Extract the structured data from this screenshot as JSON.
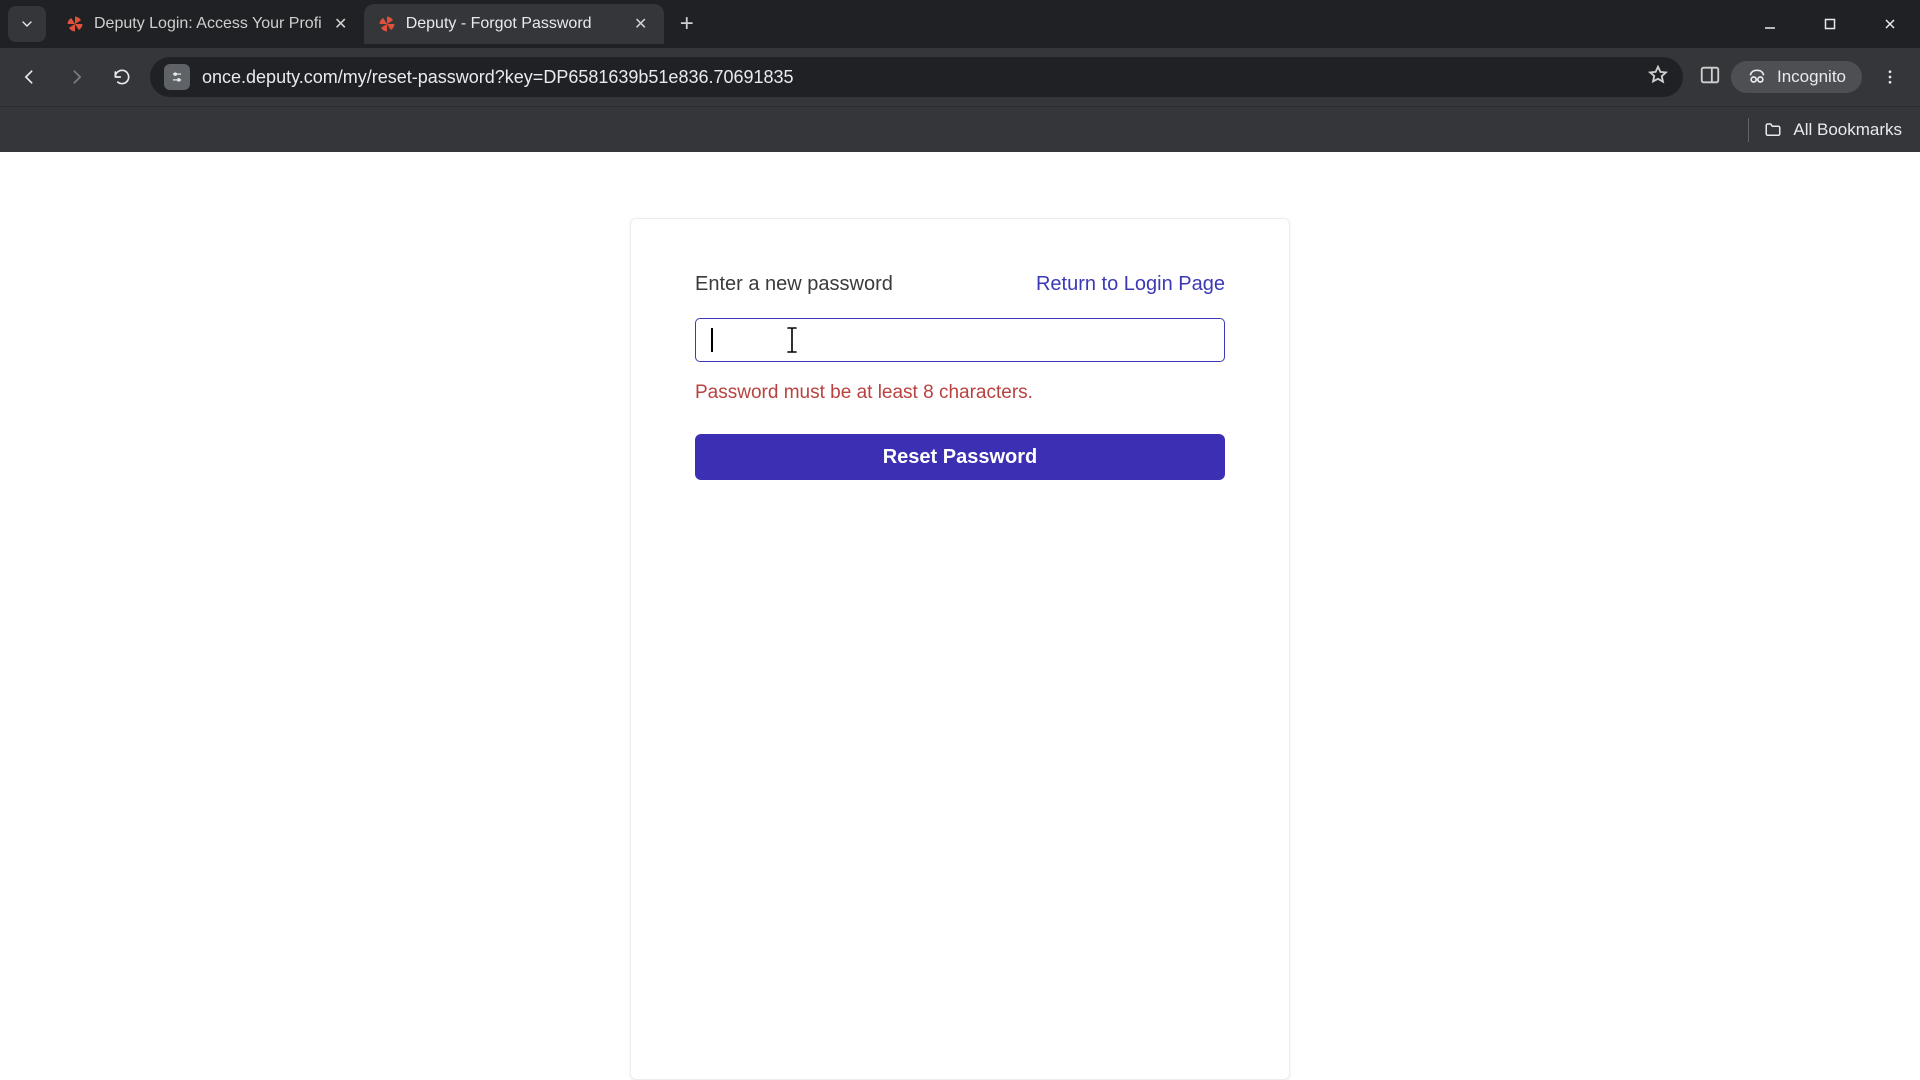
{
  "browser": {
    "tabs": [
      {
        "title": "Deputy Login: Access Your Profi",
        "active": false
      },
      {
        "title": "Deputy - Forgot Password",
        "active": true
      }
    ],
    "url": "once.deputy.com/my/reset-password?key=DP6581639b51e836.70691835",
    "incognito_label": "Incognito",
    "bookmarks_label": "All Bookmarks"
  },
  "form": {
    "label": "Enter a new password",
    "return_link": "Return to Login Page",
    "password_value": "",
    "error": "Password must be at least 8 characters.",
    "submit": "Reset Password"
  },
  "colors": {
    "accent": "#3c2fb3",
    "link": "#3c39b5",
    "error": "#b8423f"
  }
}
